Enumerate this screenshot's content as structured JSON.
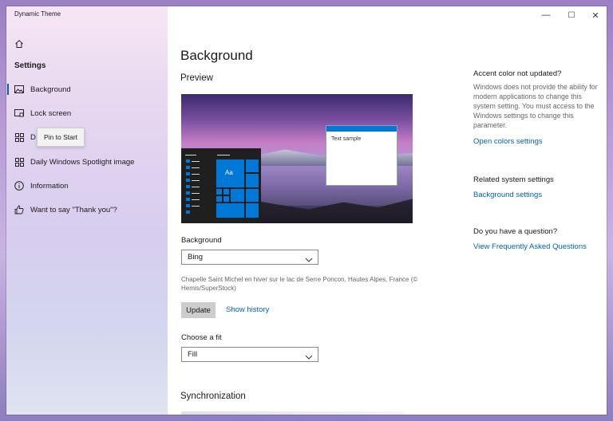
{
  "window": {
    "title": "Dynamic Theme",
    "minimize": "—",
    "maximize": "☐",
    "close": "✕"
  },
  "sidebar": {
    "heading": "Settings",
    "items": [
      {
        "label": "Background",
        "icon": "image-icon"
      },
      {
        "label": "Lock screen",
        "icon": "lock-screen-icon"
      },
      {
        "label": "D",
        "icon": "grid-icon"
      },
      {
        "label": "Daily Windows Spotlight image",
        "icon": "grid-icon"
      },
      {
        "label": "Information",
        "icon": "info-icon"
      },
      {
        "label": "Want to say \"Thank you\"?",
        "icon": "thumbs-up-icon"
      }
    ],
    "tooltip": "Pin to Start"
  },
  "main": {
    "title": "Background",
    "preview_heading": "Preview",
    "preview": {
      "tile_label": "Aa",
      "sample_text": "Text sample"
    },
    "background_label": "Background",
    "background_value": "Bing",
    "credit": "Chapelle Saint Michel en hiver sur le lac de Serre Poncon, Hautes Alpes, France (© Hemis/SuperStock)",
    "update_label": "Update",
    "history_label": "Show history",
    "fit_label": "Choose a fit",
    "fit_value": "Fill",
    "sync_heading": "Synchronization"
  },
  "right": {
    "accent_heading": "Accent color not updated?",
    "accent_body": "Windows does not provide the ability for modern applications to change this system setting. You must access to the Windows settings to change this parameter.",
    "accent_link": "Open colors settings",
    "related_heading": "Related system settings",
    "related_link": "Background settings",
    "question_heading": "Do you have a question?",
    "question_link": "View Frequently Asked Questions"
  },
  "colors": {
    "accent": "#0063b1",
    "tile": "#0078d7"
  }
}
